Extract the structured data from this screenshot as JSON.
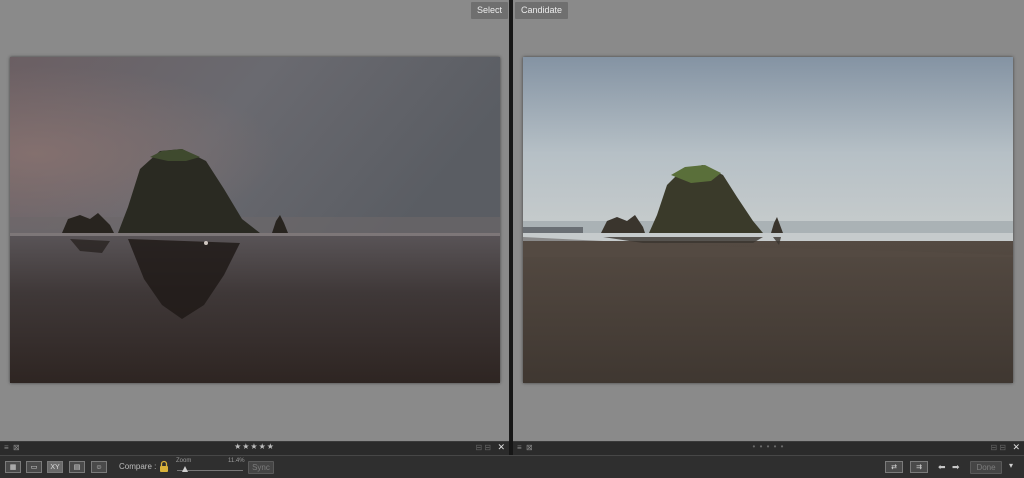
{
  "panes": {
    "select": {
      "label": "Select",
      "footer_left": "≡ ⊠",
      "rating": "★★★★★",
      "footer_right": "⊟ ⊟",
      "close": "✕"
    },
    "candidate": {
      "label": "Candidate",
      "footer_left": "≡ ⊠",
      "rating": "• • • • •",
      "footer_right": "⊟ ⊟",
      "close": "✕"
    }
  },
  "toolbar": {
    "view_grid": "▦",
    "view_loupe": "▭",
    "view_compare": "XY",
    "view_survey": "▤",
    "view_people": "☺",
    "compare_label": "Compare :",
    "zoom_label": "Zoom",
    "zoom_value": "11.4%",
    "zoom_level": 0.114,
    "sync_label": "Sync",
    "swap_icon": "⇄",
    "make_select_icon": "⇉",
    "prev": "⬅",
    "next": "➡",
    "done_label": "Done",
    "menu": "▾"
  },
  "colors": {
    "pane_bg": "#8a8a8a",
    "toolbar_bg": "#2f2f2f",
    "lock_gold": "#d9b23a"
  }
}
